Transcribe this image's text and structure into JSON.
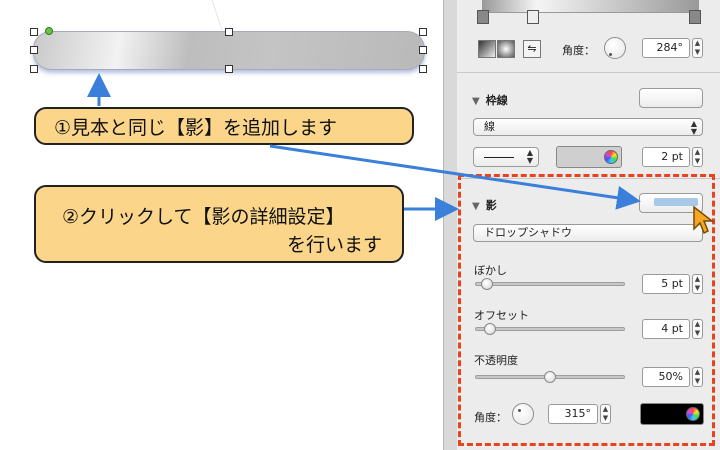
{
  "callouts": {
    "step1": "①見本と同じ【影】を追加します",
    "step2_line1": "②クリックして【影の詳細設定】",
    "step2_line2": "を行います"
  },
  "panel": {
    "fill_angle_label": "角度：",
    "fill_angle_value": "284°",
    "stroke": {
      "title": "枠線",
      "style_value": "線",
      "width_value": "2 pt"
    },
    "shadow": {
      "title": "影",
      "type_value": "ドロップシャドウ",
      "blur_label": "ぼかし",
      "blur_value": "5 pt",
      "blur_level": 0.05,
      "offset_label": "オフセット",
      "offset_value": "4 pt",
      "offset_level": 0.04,
      "opacity_label": "不透明度",
      "opacity_value": "50%",
      "opacity_level": 0.5,
      "angle_label": "角度：",
      "angle_value": "315°",
      "color": "#000000"
    }
  },
  "colors": {
    "callout_fill": "#fbd68a",
    "arrow": "#3a7fd9",
    "highlight_border": "#e8431c",
    "shadow_swatch": "#a9c8e6"
  },
  "icons": {
    "swap": "arrows-swap-icon",
    "color_wheel": "color-wheel-icon"
  }
}
